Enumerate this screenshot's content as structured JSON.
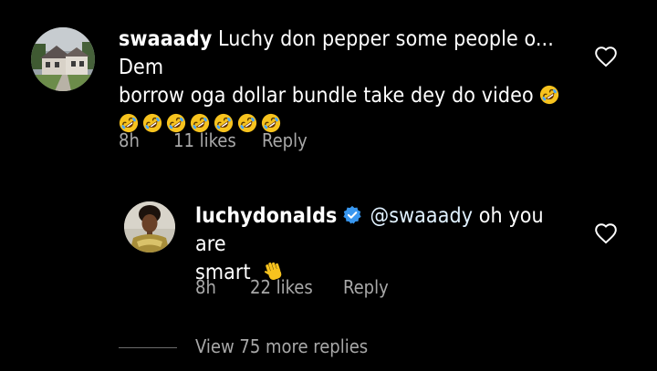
{
  "comment": {
    "username": "swaaady",
    "line1": "Luchy don pepper some people o... Dem",
    "line2": "borrow oga dollar bundle take dey do video",
    "emoji_icon": "laughing-crying-emoji",
    "emoji_count_line3": 7,
    "time": "8h",
    "likes": "11 likes",
    "reply": "Reply"
  },
  "reply_comment": {
    "username": "luchydonalds",
    "verified": true,
    "mention": "@swaaady",
    "text_line1": "oh you are",
    "text_line2": "smart",
    "emoji_icon": "waving-hand-emoji",
    "time": "8h",
    "likes": "22 likes",
    "reply": "Reply"
  },
  "view_more_replies": "View 75 more replies",
  "colors": {
    "background": "#000000",
    "text": "#ffffff",
    "secondary": "#a8a8a8",
    "verified_blue": "#3897f0",
    "emoji_yellow": "#f7c31e"
  }
}
